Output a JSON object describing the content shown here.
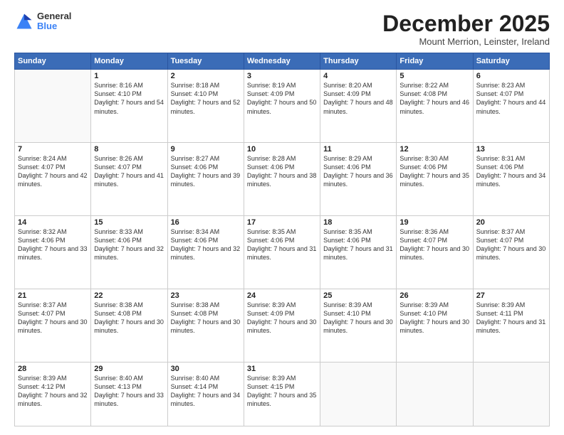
{
  "logo": {
    "general": "General",
    "blue": "Blue"
  },
  "header": {
    "month": "December 2025",
    "location": "Mount Merrion, Leinster, Ireland"
  },
  "days_of_week": [
    "Sunday",
    "Monday",
    "Tuesday",
    "Wednesday",
    "Thursday",
    "Friday",
    "Saturday"
  ],
  "weeks": [
    [
      {
        "day": null,
        "data": null
      },
      {
        "day": "1",
        "sunrise": "8:16 AM",
        "sunset": "4:10 PM",
        "daylight": "7 hours and 54 minutes."
      },
      {
        "day": "2",
        "sunrise": "8:18 AM",
        "sunset": "4:10 PM",
        "daylight": "7 hours and 52 minutes."
      },
      {
        "day": "3",
        "sunrise": "8:19 AM",
        "sunset": "4:09 PM",
        "daylight": "7 hours and 50 minutes."
      },
      {
        "day": "4",
        "sunrise": "8:20 AM",
        "sunset": "4:09 PM",
        "daylight": "7 hours and 48 minutes."
      },
      {
        "day": "5",
        "sunrise": "8:22 AM",
        "sunset": "4:08 PM",
        "daylight": "7 hours and 46 minutes."
      },
      {
        "day": "6",
        "sunrise": "8:23 AM",
        "sunset": "4:07 PM",
        "daylight": "7 hours and 44 minutes."
      }
    ],
    [
      {
        "day": "7",
        "sunrise": "8:24 AM",
        "sunset": "4:07 PM",
        "daylight": "7 hours and 42 minutes."
      },
      {
        "day": "8",
        "sunrise": "8:26 AM",
        "sunset": "4:07 PM",
        "daylight": "7 hours and 41 minutes."
      },
      {
        "day": "9",
        "sunrise": "8:27 AM",
        "sunset": "4:06 PM",
        "daylight": "7 hours and 39 minutes."
      },
      {
        "day": "10",
        "sunrise": "8:28 AM",
        "sunset": "4:06 PM",
        "daylight": "7 hours and 38 minutes."
      },
      {
        "day": "11",
        "sunrise": "8:29 AM",
        "sunset": "4:06 PM",
        "daylight": "7 hours and 36 minutes."
      },
      {
        "day": "12",
        "sunrise": "8:30 AM",
        "sunset": "4:06 PM",
        "daylight": "7 hours and 35 minutes."
      },
      {
        "day": "13",
        "sunrise": "8:31 AM",
        "sunset": "4:06 PM",
        "daylight": "7 hours and 34 minutes."
      }
    ],
    [
      {
        "day": "14",
        "sunrise": "8:32 AM",
        "sunset": "4:06 PM",
        "daylight": "7 hours and 33 minutes."
      },
      {
        "day": "15",
        "sunrise": "8:33 AM",
        "sunset": "4:06 PM",
        "daylight": "7 hours and 32 minutes."
      },
      {
        "day": "16",
        "sunrise": "8:34 AM",
        "sunset": "4:06 PM",
        "daylight": "7 hours and 32 minutes."
      },
      {
        "day": "17",
        "sunrise": "8:35 AM",
        "sunset": "4:06 PM",
        "daylight": "7 hours and 31 minutes."
      },
      {
        "day": "18",
        "sunrise": "8:35 AM",
        "sunset": "4:06 PM",
        "daylight": "7 hours and 31 minutes."
      },
      {
        "day": "19",
        "sunrise": "8:36 AM",
        "sunset": "4:07 PM",
        "daylight": "7 hours and 30 minutes."
      },
      {
        "day": "20",
        "sunrise": "8:37 AM",
        "sunset": "4:07 PM",
        "daylight": "7 hours and 30 minutes."
      }
    ],
    [
      {
        "day": "21",
        "sunrise": "8:37 AM",
        "sunset": "4:07 PM",
        "daylight": "7 hours and 30 minutes."
      },
      {
        "day": "22",
        "sunrise": "8:38 AM",
        "sunset": "4:08 PM",
        "daylight": "7 hours and 30 minutes."
      },
      {
        "day": "23",
        "sunrise": "8:38 AM",
        "sunset": "4:08 PM",
        "daylight": "7 hours and 30 minutes."
      },
      {
        "day": "24",
        "sunrise": "8:39 AM",
        "sunset": "4:09 PM",
        "daylight": "7 hours and 30 minutes."
      },
      {
        "day": "25",
        "sunrise": "8:39 AM",
        "sunset": "4:10 PM",
        "daylight": "7 hours and 30 minutes."
      },
      {
        "day": "26",
        "sunrise": "8:39 AM",
        "sunset": "4:10 PM",
        "daylight": "7 hours and 30 minutes."
      },
      {
        "day": "27",
        "sunrise": "8:39 AM",
        "sunset": "4:11 PM",
        "daylight": "7 hours and 31 minutes."
      }
    ],
    [
      {
        "day": "28",
        "sunrise": "8:39 AM",
        "sunset": "4:12 PM",
        "daylight": "7 hours and 32 minutes."
      },
      {
        "day": "29",
        "sunrise": "8:40 AM",
        "sunset": "4:13 PM",
        "daylight": "7 hours and 33 minutes."
      },
      {
        "day": "30",
        "sunrise": "8:40 AM",
        "sunset": "4:14 PM",
        "daylight": "7 hours and 34 minutes."
      },
      {
        "day": "31",
        "sunrise": "8:39 AM",
        "sunset": "4:15 PM",
        "daylight": "7 hours and 35 minutes."
      },
      {
        "day": null,
        "data": null
      },
      {
        "day": null,
        "data": null
      },
      {
        "day": null,
        "data": null
      }
    ]
  ]
}
